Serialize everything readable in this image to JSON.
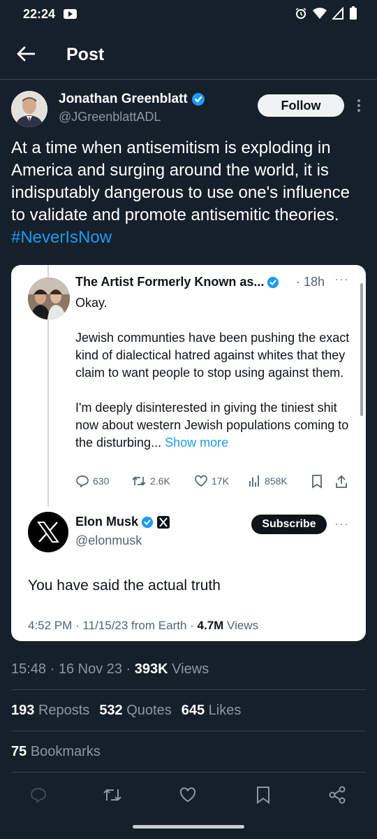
{
  "status_bar": {
    "time": "22:24"
  },
  "header": {
    "title": "Post"
  },
  "author": {
    "name": "Jonathan Greenblatt",
    "handle": "@JGreenblattADL",
    "follow_label": "Follow"
  },
  "tweet": {
    "text": "At a time when antisemitism is exploding in America and surging around the world, it is indisputably dangerous to use one's influence to validate and promote antisemitic theories.",
    "hashtag": "#NeverIsNow"
  },
  "quoted": {
    "name": "The Artist Formerly Known as...",
    "time": "18h",
    "line1": "Okay.",
    "line2": "Jewish communties have been pushing the exact kind of dialectical hatred against whites that they claim to want people to stop using against them.",
    "line3": "I'm deeply disinterested in giving the tiniest shit now about western Jewish populations coming to the disturbing...",
    "show_more": "Show more",
    "replies": "630",
    "reposts": "2.6K",
    "likes": "17K",
    "views": "858K"
  },
  "reply": {
    "name": "Elon Musk",
    "handle": "@elonmusk",
    "subscribe_label": "Subscribe",
    "text": "You have said the actual truth",
    "meta_prefix": "4:52 PM · 11/15/23 from Earth · ",
    "views_count": "4.7M",
    "views_label": " Views"
  },
  "post_meta": {
    "datetime": "15:48 · 16 Nov 23 · ",
    "views_count": "393K",
    "views_label": " Views"
  },
  "stats": {
    "reposts_count": "193",
    "reposts_label": "Reposts",
    "quotes_count": "532",
    "quotes_label": "Quotes",
    "likes_count": "645",
    "likes_label": "Likes",
    "bookmarks_count": "75",
    "bookmarks_label": "Bookmarks"
  },
  "colors": {
    "accent": "#1d9bf0",
    "background": "#15202b",
    "muted": "#8b98a5"
  }
}
